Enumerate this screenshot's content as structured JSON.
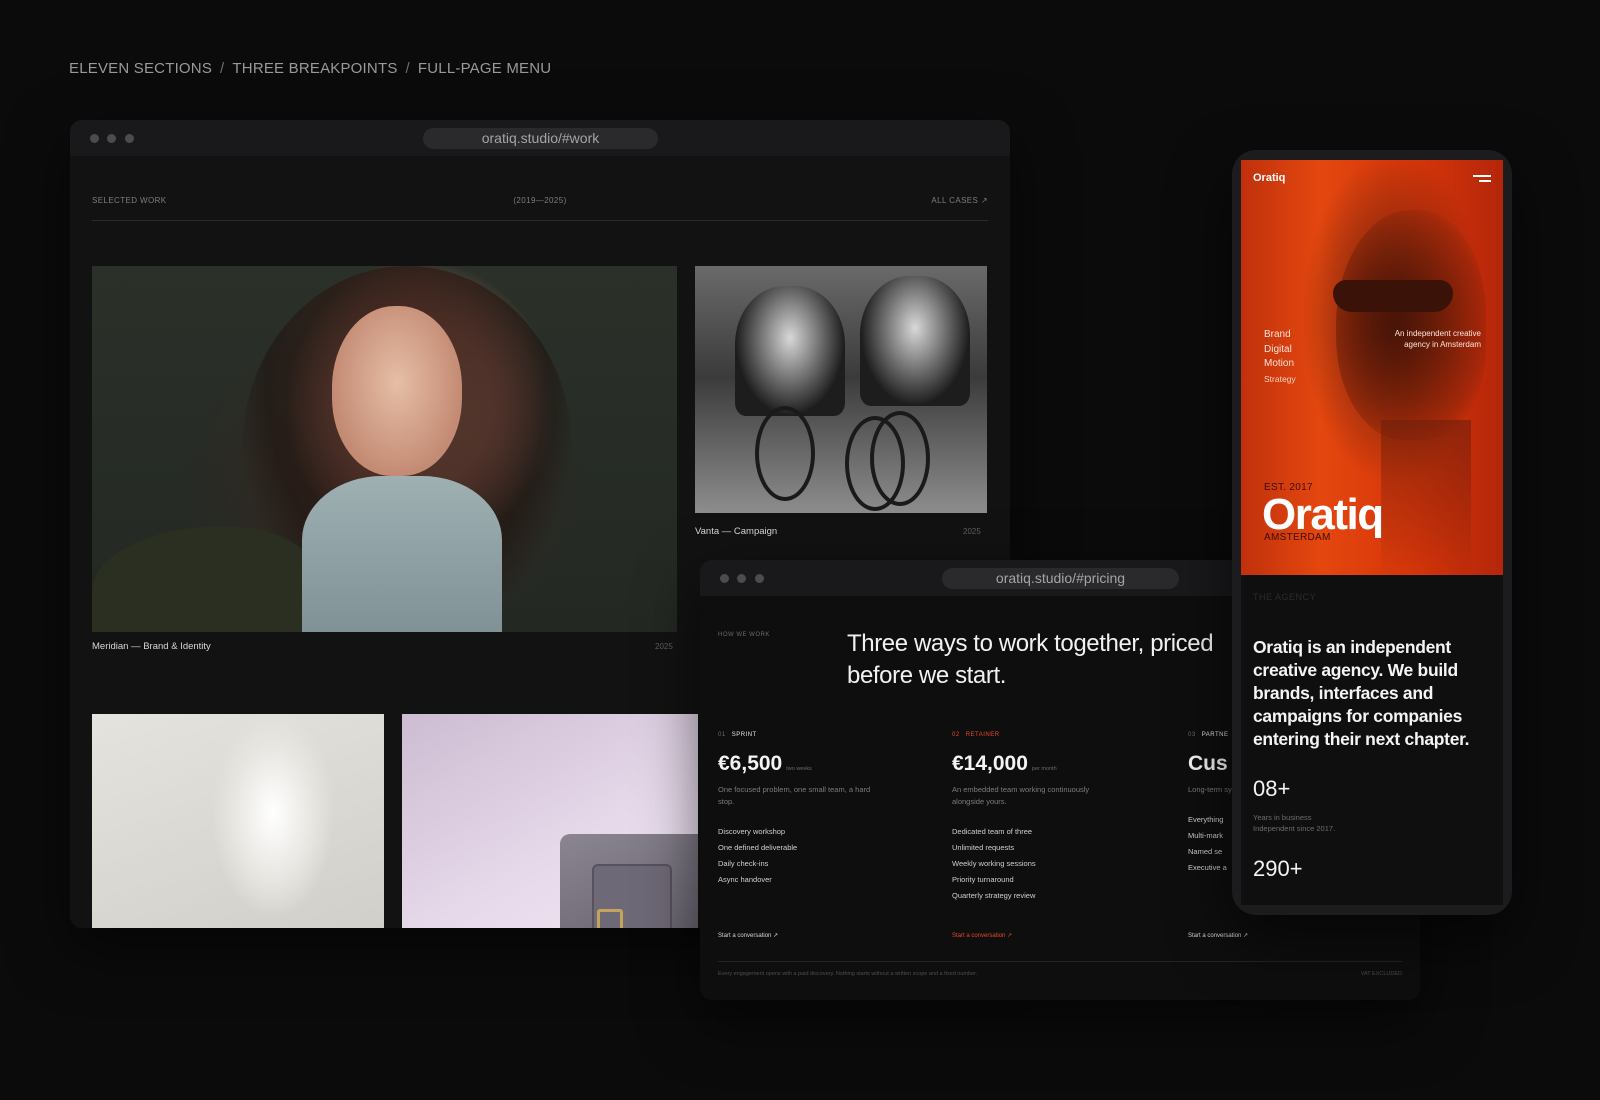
{
  "caption": {
    "part1": "ELEVEN SECTIONS",
    "part2": "THREE BREAKPOINTS",
    "part3": "FULL-PAGE MENU",
    "separator": "/"
  },
  "work_window": {
    "url": "oratiq.studio/#work",
    "header": {
      "left": "SELECTED WORK",
      "center": "(2019—2025)",
      "right": "ALL CASES ↗"
    },
    "cases": [
      {
        "title": "Meridian — Brand & Identity",
        "year": "2025"
      },
      {
        "title": "Vanta — Campaign",
        "year": "2025"
      }
    ]
  },
  "pricing_window": {
    "url": "oratiq.studio/#pricing",
    "eyebrow": "HOW WE WORK",
    "headline": "Three ways to work together, priced before we start.",
    "plans": [
      {
        "num": "01",
        "name": "SPRINT",
        "price": "€6,500",
        "per": "two weeks",
        "desc": "One focused problem, one small team, a hard stop.",
        "features": [
          "Discovery workshop",
          "One defined deliverable",
          "Daily check-ins",
          "Async handover"
        ],
        "cta": "Start a conversation ↗"
      },
      {
        "num": "02",
        "name": "RETAINER",
        "price": "€14,000",
        "per": "per month",
        "desc": "An embedded team working continuously alongside yours.",
        "features": [
          "Dedicated team of three",
          "Unlimited requests",
          "Weekly working sessions",
          "Priority turnaround",
          "Quarterly strategy review"
        ],
        "cta": "Start a conversation ↗"
      },
      {
        "num": "03",
        "name": "PARTNE",
        "price": "Cus",
        "per": "",
        "desc": "Long-term system.",
        "features": [
          "Everything",
          "Multi-mark",
          "Named se",
          "Executive a"
        ],
        "cta": "Start a conversation ↗"
      }
    ],
    "footer_left": "Every engagement opens with a paid discovery. Nothing starts without a written scope and a fixed number.",
    "footer_right": "VAT EXCLUDED"
  },
  "phone": {
    "brand": "Oratiq",
    "services": [
      "Brand",
      "Digital",
      "Motion",
      "Strategy"
    ],
    "tagline": "An independent creative agency in Amsterdam",
    "est": "EST. 2017",
    "wordmark": "Oratiq",
    "city": "AMSTERDAM",
    "section_label": "THE AGENCY",
    "about": "Oratiq is an independent creative agency. We build brands, interfaces and campaigns for companies entering their next chapter.",
    "stat1_value": "08+",
    "stat1_label_line1": "Years in business",
    "stat1_label_line2": "Independent since 2017.",
    "stat2_value": "290+"
  },
  "colors": {
    "background": "#0b0b0b",
    "accent": "#e8482a",
    "hero_orange": "#e4470f"
  }
}
